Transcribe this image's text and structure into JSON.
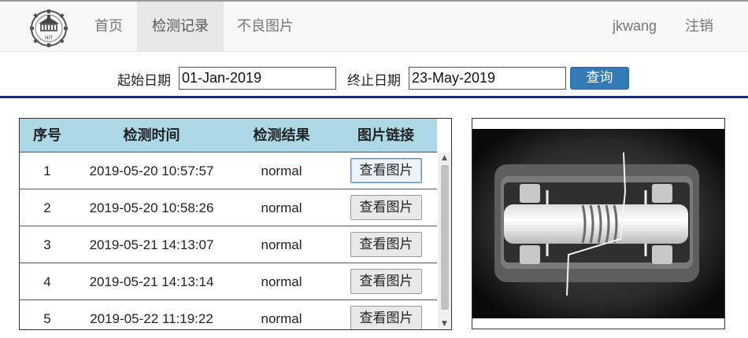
{
  "nav": {
    "items": [
      "首页",
      "检测记录",
      "不良图片"
    ],
    "user": "jkwang",
    "logout": "注销",
    "active_index": 1,
    "logo_text": "HIT"
  },
  "filter": {
    "start_label": "起始日期",
    "start_value": "01-Jan-2019",
    "end_label": "终止日期",
    "end_value": "23-May-2019",
    "query_label": "查询"
  },
  "table": {
    "headers": [
      "序号",
      "检测时间",
      "检测结果",
      "图片链接"
    ],
    "rows": [
      {
        "index": "1",
        "time": "2019-05-20 10:57:57",
        "result": "normal",
        "link": "查看图片"
      },
      {
        "index": "2",
        "time": "2019-05-20 10:58:26",
        "result": "normal",
        "link": "查看图片"
      },
      {
        "index": "3",
        "time": "2019-05-21 14:13:07",
        "result": "normal",
        "link": "查看图片"
      },
      {
        "index": "4",
        "time": "2019-05-21 14:13:14",
        "result": "normal",
        "link": "查看图片"
      },
      {
        "index": "5",
        "time": "2019-05-22 11:19:22",
        "result": "normal",
        "link": "查看图片"
      }
    ]
  },
  "colors": {
    "header_bg": "#add8e6",
    "primary_button": "#337ab7",
    "divider": "#1a2a6c"
  },
  "icons": {
    "logo": "university-seal-icon",
    "scroll_up": "scroll-up-arrow-icon",
    "scroll_down": "scroll-down-arrow-icon"
  }
}
